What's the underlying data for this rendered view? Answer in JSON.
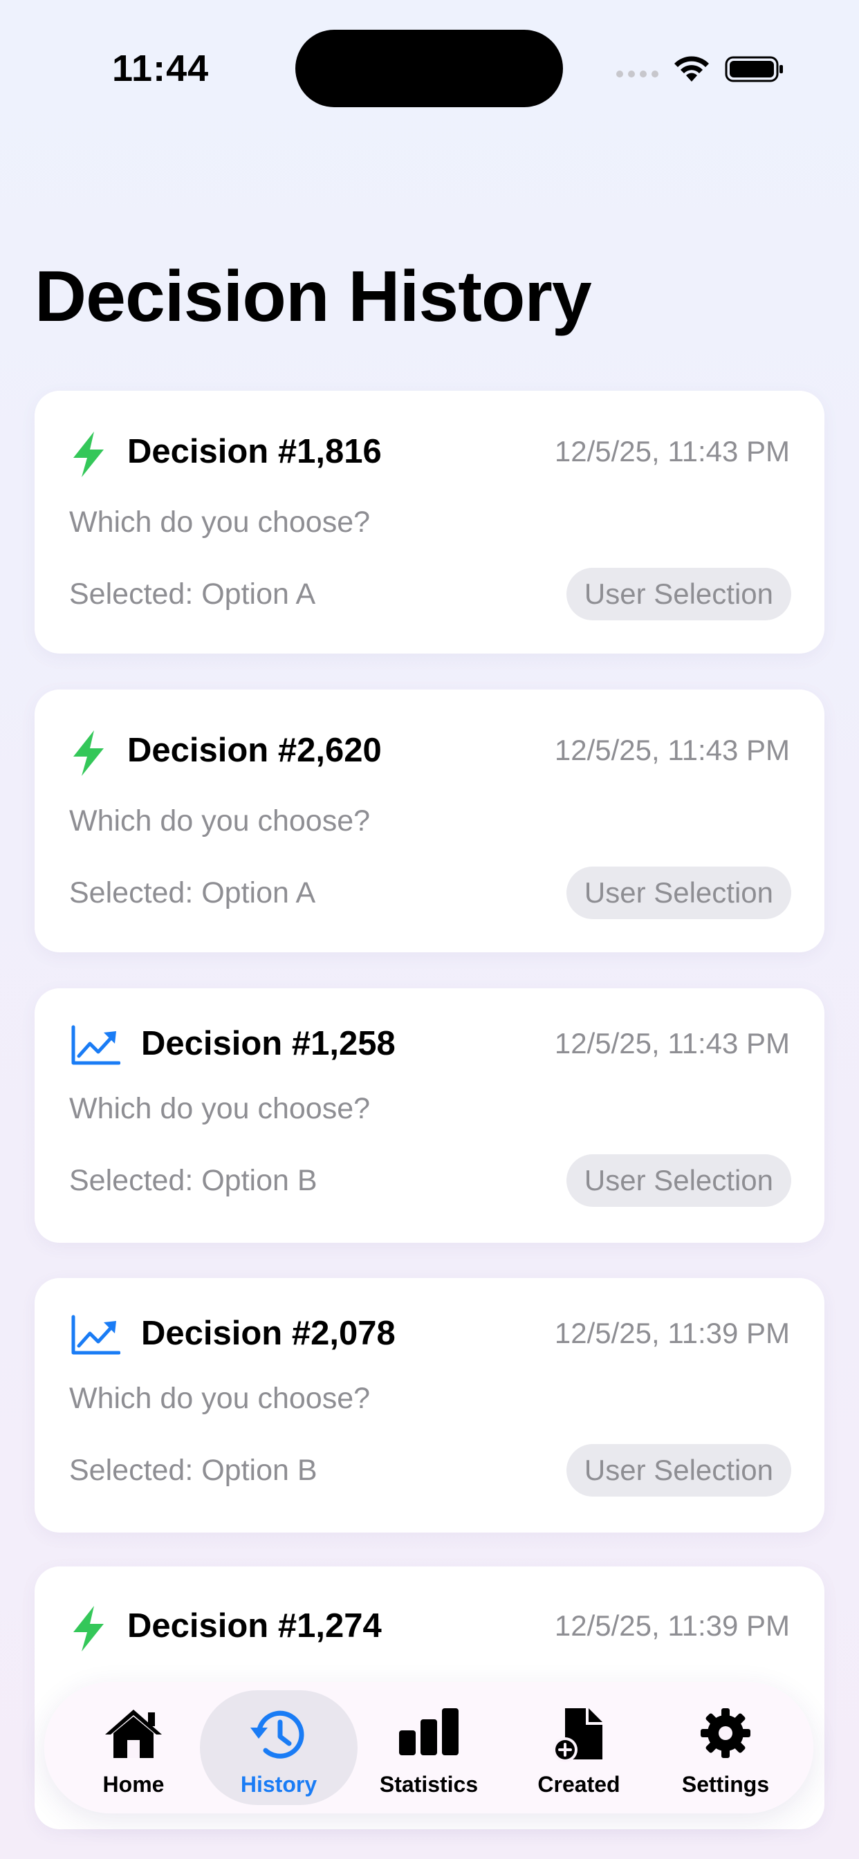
{
  "status_bar": {
    "time": "11:44"
  },
  "page_title": "Decision History",
  "cards": [
    {
      "icon": "bolt-icon",
      "icon_color": "#34c759",
      "title": "Decision #1,816",
      "date": "12/5/25, 11:43 PM",
      "question": "Which do you choose?",
      "selected": "Selected: Option A",
      "badge": "User Selection"
    },
    {
      "icon": "bolt-icon",
      "icon_color": "#34c759",
      "title": "Decision #2,620",
      "date": "12/5/25, 11:43 PM",
      "question": "Which do you choose?",
      "selected": "Selected: Option A",
      "badge": "User Selection"
    },
    {
      "icon": "trend-chart-icon",
      "icon_color": "#1a7cf5",
      "title": "Decision #1,258",
      "date": "12/5/25, 11:43 PM",
      "question": "Which do you choose?",
      "selected": "Selected: Option B",
      "badge": "User Selection"
    },
    {
      "icon": "trend-chart-icon",
      "icon_color": "#1a7cf5",
      "title": "Decision #2,078",
      "date": "12/5/25, 11:39 PM",
      "question": "Which do you choose?",
      "selected": "Selected: Option B",
      "badge": "User Selection"
    },
    {
      "icon": "bolt-icon",
      "icon_color": "#34c759",
      "title": "Decision #1,274",
      "date": "12/5/25, 11:39 PM",
      "question": "",
      "selected": "",
      "badge": ""
    }
  ],
  "tabs": [
    {
      "label": "Home",
      "icon": "house-icon"
    },
    {
      "label": "History",
      "icon": "clock-history-icon",
      "active": true
    },
    {
      "label": "Statistics",
      "icon": "bar-chart-icon"
    },
    {
      "label": "Created",
      "icon": "document-add-icon"
    },
    {
      "label": "Settings",
      "icon": "gear-icon"
    }
  ],
  "colors": {
    "accent": "#1a7cf5",
    "bolt": "#34c759",
    "secondary_text": "#8e8e93",
    "badge_bg": "#e9e9ee"
  }
}
